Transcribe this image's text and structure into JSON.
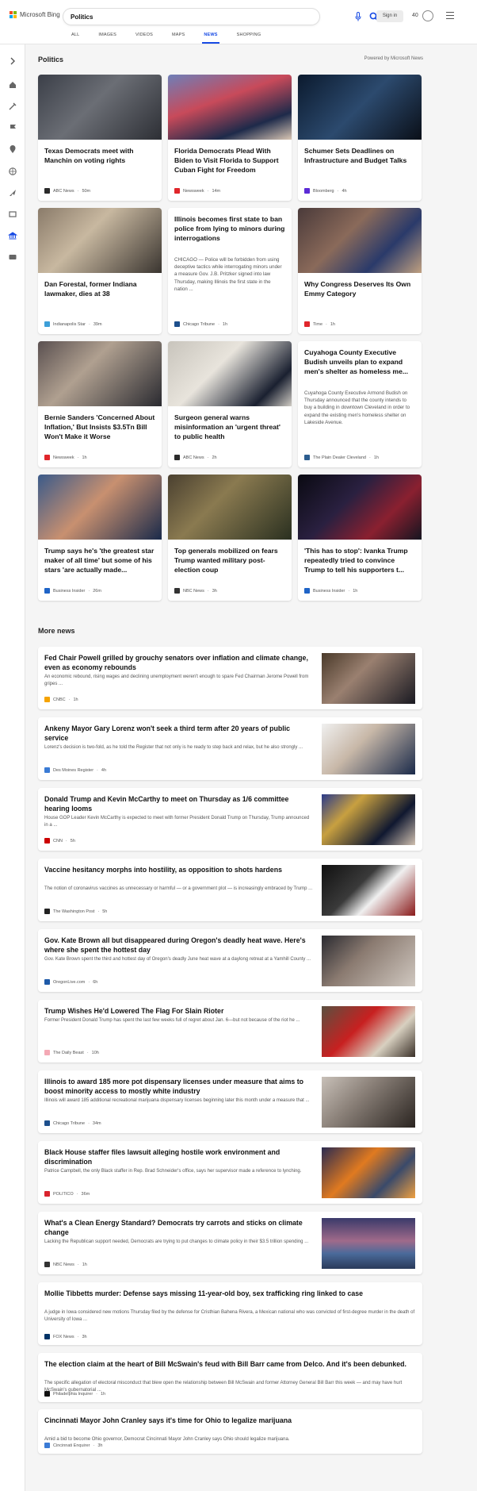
{
  "brand": "Microsoft Bing",
  "search": {
    "value": "Politics"
  },
  "header": {
    "signin": "Sign in",
    "points": "40"
  },
  "tabs": [
    "ALL",
    "IMAGES",
    "VIDEOS",
    "MAPS",
    "NEWS",
    "SHOPPING"
  ],
  "active_tab": "NEWS",
  "section": {
    "title": "Politics",
    "powered": "Powered by Microsoft News"
  },
  "cards": [
    {
      "title": "Texas Democrats meet with Manchin on voting rights",
      "source": "ABC News",
      "time": "50m",
      "color": "#2b2b2b"
    },
    {
      "title": "Florida Democrats Plead With Biden to Visit Florida to Support Cuban Fight for Freedom",
      "source": "Newsweek",
      "time": "14m",
      "color": "#e0262b"
    },
    {
      "title": "Schumer Sets Deadlines on Infrastructure and Budget Talks",
      "source": "Bloomberg",
      "time": "4h",
      "color": "#5b2bd6"
    },
    {
      "title": "Dan Forestal, former Indiana lawmaker, dies at 38",
      "source": "Indianapolis Star",
      "time": "39m",
      "color": "#3d9fd8"
    },
    {
      "title": "Illinois becomes first state to ban police from lying to minors during interrogations",
      "summary": "CHICAGO — Police will be forbidden from using deceptive tactics while interrogating minors under a measure Gov. J.B. Pritzker signed into law Thursday, making Illinois the first state in the nation ...",
      "source": "Chicago Tribune",
      "time": "1h",
      "color": "#1d4f8c"
    },
    {
      "title": "Why Congress Deserves Its Own Emmy Category",
      "source": "Time",
      "time": "1h",
      "color": "#e0262b"
    },
    {
      "title": "Bernie Sanders 'Concerned About Inflation,' But Insists $3.5Tn Bill Won't Make it Worse",
      "source": "Newsweek",
      "time": "1h",
      "color": "#e0262b"
    },
    {
      "title": "Surgeon general warns misinformation an 'urgent threat' to public health",
      "source": "ABC News",
      "time": "2h",
      "color": "#2b2b2b"
    },
    {
      "title": "Cuyahoga County Executive Budish unveils plan to expand men's shelter as homeless me...",
      "summary": "Cuyahoga County Executive Armond Budish on Thursday announced that the county intends to buy a building in downtown Cleveland in order to expand the existing men's homeless shelter on Lakeside Avenue.",
      "source": "The Plain Dealer Cleveland",
      "time": "1h",
      "color": "#2c5d8f"
    },
    {
      "title": "Trump says he's 'the greatest star maker of all time' but some of his stars 'are actually made...",
      "source": "Business Insider",
      "time": "26m",
      "color": "#1f64c7"
    },
    {
      "title": "Top generals mobilized on fears Trump wanted military post-election coup",
      "source": "NBC News",
      "time": "3h",
      "color": "#333333"
    },
    {
      "title": "'This has to stop': Ivanka Trump repeatedly tried to convince Trump to tell his supporters t...",
      "source": "Business Insider",
      "time": "1h",
      "color": "#1f64c7"
    }
  ],
  "more": {
    "title": "More news",
    "items": [
      {
        "title": "Fed Chair Powell grilled by grouchy senators over inflation and climate change, even as economy rebounds",
        "summary": "An economic rebound, rising wages and declining unemployment weren't enough to spare Fed Chairman Jerome Powell from gripes ...",
        "source": "CNBC",
        "time": "1h",
        "color": "#f5a300"
      },
      {
        "title": "Ankeny Mayor Gary Lorenz won't seek a third term after 20 years of public service",
        "summary": "Lorenz's decision is two-fold, as he told the Register that not only is he ready to step back and relax, but he also strongly ...",
        "source": "Des Moines Register",
        "time": "4h",
        "color": "#3a7bd5"
      },
      {
        "title": "Donald Trump and Kevin McCarthy to meet on Thursday as 1/6 committee hearing looms",
        "summary": "House GOP Leader Kevin McCarthy is expected to meet with former President Donald Trump on Thursday, Trump announced in a ...",
        "source": "CNN",
        "time": "5h",
        "color": "#cc0000"
      },
      {
        "title": "Vaccine hesitancy morphs into hostility, as opposition to shots hardens",
        "summary": "The notion of coronavirus vaccines as unnecessary or harmful — or a government plot — is increasingly embraced by Trump ...",
        "source": "The Washington Post",
        "time": "5h",
        "color": "#222222"
      },
      {
        "title": "Gov. Kate Brown all but disappeared during Oregon's deadly heat wave. Here's where she spent the hottest day",
        "summary": "Gov. Kate Brown spent the third and hottest day of Oregon's deadly June heat wave at a daylong retreat at a Yamhill County ...",
        "source": "OregonLive.com",
        "time": "6h",
        "color": "#1e5aa8"
      },
      {
        "title": "Trump Wishes He'd Lowered The Flag For Slain Rioter",
        "summary": "Former President Donald Trump has spent the last few weeks full of regret about Jan. 6—but not because of the riot he ...",
        "source": "The Daily Beast",
        "time": "10h",
        "color": "#f4a9b5"
      },
      {
        "title": "Illinois to award 185 more pot dispensary licenses under measure that aims to boost minority access to mostly white industry",
        "summary": "Illinois will award 185 additional recreational marijuana dispensary licenses beginning later this month under a measure that ...",
        "source": "Chicago Tribune",
        "time": "34m",
        "color": "#1d4f8c"
      },
      {
        "title": "Black House staffer files lawsuit alleging hostile work environment and discrimination",
        "summary": "Patrice Campbell, the only Black staffer in Rep. Brad Schneider's office, says her supervisor made a reference to lynching.",
        "source": "POLITICO",
        "time": "36m",
        "color": "#d9232d"
      },
      {
        "title": "What's a Clean Energy Standard? Democrats try carrots and sticks on climate change",
        "summary": "Lacking the Republican support needed, Democrats are trying to put changes to climate policy in their $3.5 trillion spending ...",
        "source": "NBC News",
        "time": "1h",
        "color": "#333333"
      },
      {
        "title": "Mollie Tibbetts murder: Defense says missing 11-year-old boy, sex trafficking ring linked to case",
        "summary": "A judge in Iowa considered new motions Thursday filed by the defense for Cristhian Bahena Rivera, a Mexican national who was convicted of first-degree murder in the death of University of Iowa ...",
        "source": "FOX News",
        "time": "3h",
        "color": "#003366"
      },
      {
        "title": "The election claim at the heart of Bill McSwain's feud with Bill Barr came from Delco. And it's been debunked.",
        "summary": "The specific allegation of electoral misconduct that blew open the relationship between Bill McSwain and former Attorney General Bill Barr this week — and may have hurt McSwain's gubernatorial ...",
        "source": "Philadelphia Inquirer",
        "time": "1h",
        "color": "#111111"
      },
      {
        "title": "Cincinnati Mayor John Cranley says it's time for Ohio to legalize marijuana",
        "summary": "Amid a bid to become Ohio governor, Democrat Cincinnati Mayor John Cranley says Ohio should legalize marijuana.",
        "source": "Cincinnati Enquirer",
        "time": "3h",
        "color": "#3a7bd5"
      }
    ]
  },
  "icons": [
    "expand-icon",
    "home-icon",
    "tools-icon",
    "flag-icon",
    "location-icon",
    "globe-icon",
    "plane-icon",
    "tv-icon",
    "bank-icon",
    "card-icon"
  ]
}
